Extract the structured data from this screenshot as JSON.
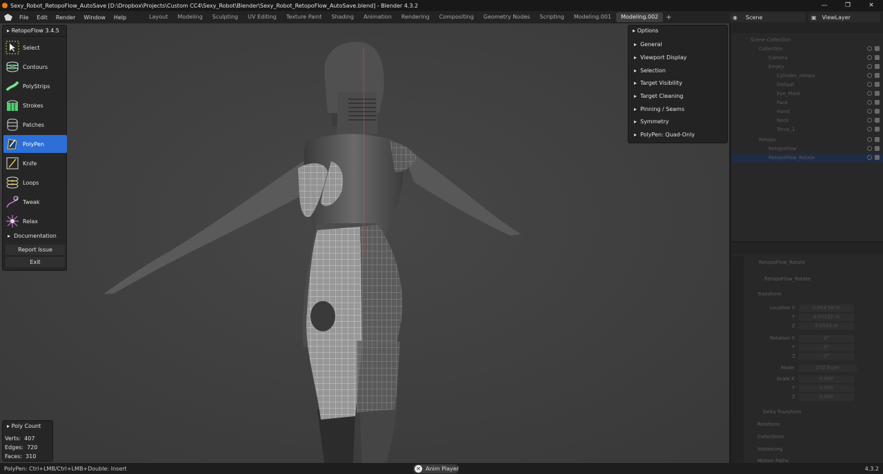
{
  "window": {
    "title": "Sexy_Robot_RetopoFlow_AutoSave [D:\\Dropbox\\Projects\\Custom CC4\\Sexy_Robot\\Blender\\Sexy_Robot_RetopoFlow_AutoSave.blend] - Blender 4.3.2",
    "controls": [
      "—",
      "❐",
      "✕"
    ]
  },
  "menu": [
    "File",
    "Edit",
    "Render",
    "Window",
    "Help"
  ],
  "workspaces": [
    "Layout",
    "Modeling",
    "Sculpting",
    "UV Editing",
    "Texture Paint",
    "Shading",
    "Animation",
    "Rendering",
    "Compositing",
    "Geometry Nodes",
    "Scripting",
    "Modeling.001",
    "Modeling.002"
  ],
  "active_workspace": "Modeling.002",
  "scene": "Scene",
  "view_layer": "ViewLayer",
  "retopoflow": {
    "title": "RetopoFlow 3.4.5",
    "tools": [
      {
        "label": "Select",
        "icon": "select-icon"
      },
      {
        "label": "Contours",
        "icon": "contours-icon"
      },
      {
        "label": "PolyStrips",
        "icon": "polystrips-icon"
      },
      {
        "label": "Strokes",
        "icon": "strokes-icon"
      },
      {
        "label": "Patches",
        "icon": "patches-icon"
      },
      {
        "label": "PolyPen",
        "icon": "polypen-icon"
      },
      {
        "label": "Knife",
        "icon": "knife-icon"
      },
      {
        "label": "Loops",
        "icon": "loops-icon"
      },
      {
        "label": "Tweak",
        "icon": "tweak-icon"
      },
      {
        "label": "Relax",
        "icon": "relax-icon"
      }
    ],
    "active_tool": "PolyPen",
    "documentation": "Documentation",
    "report_issue": "Report Issue",
    "exit": "Exit"
  },
  "options": {
    "title": "Options",
    "items": [
      "General",
      "Viewport Display",
      "Selection",
      "Target Visibility",
      "Target Cleaning",
      "Pinning / Seams",
      "Symmetry",
      "PolyPen: Quad-Only"
    ]
  },
  "poly_count": {
    "title": "Poly Count",
    "verts_label": "Verts:",
    "verts": "407",
    "edges_label": "Edges:",
    "edges": "720",
    "faces_label": "Faces:",
    "faces": "310"
  },
  "outliner": {
    "rows": [
      "Scene Collection",
      "Collection",
      "Camera",
      "Empty",
      "Cylinder_retopo",
      "Default",
      "Eye_Mask",
      "Face",
      "Hand",
      "Neck",
      "Torus_1",
      "Retopo",
      "RetopoFlow",
      "RetopoFlow_Rotate"
    ]
  },
  "properties": {
    "object": "RetopoFlow_Rotate",
    "object2": "RetopoFlow_Rotate",
    "transform": "Transform",
    "location_label": "Location X",
    "location": [
      "0.654.56 m",
      "0.50132 m",
      "5.0524 m"
    ],
    "rotation_label": "Rotation X",
    "rotation": [
      "0°",
      "0°",
      "0°"
    ],
    "mode_label": "Mode",
    "mode": "XYZ Euler",
    "scale_label": "Scale X",
    "scale": [
      "0.000",
      "0.000",
      "0.000"
    ],
    "y_label": "Y",
    "z_label": "Z",
    "sections": [
      "Delta Transform",
      "Relations",
      "Collections",
      "Instancing",
      "Motion Paths"
    ]
  },
  "status": {
    "hint": "PolyPen: Ctrl+LMB/Ctrl+LMB+Double: Insert",
    "anim_player": "Anim Player",
    "version": "4.3.2"
  }
}
